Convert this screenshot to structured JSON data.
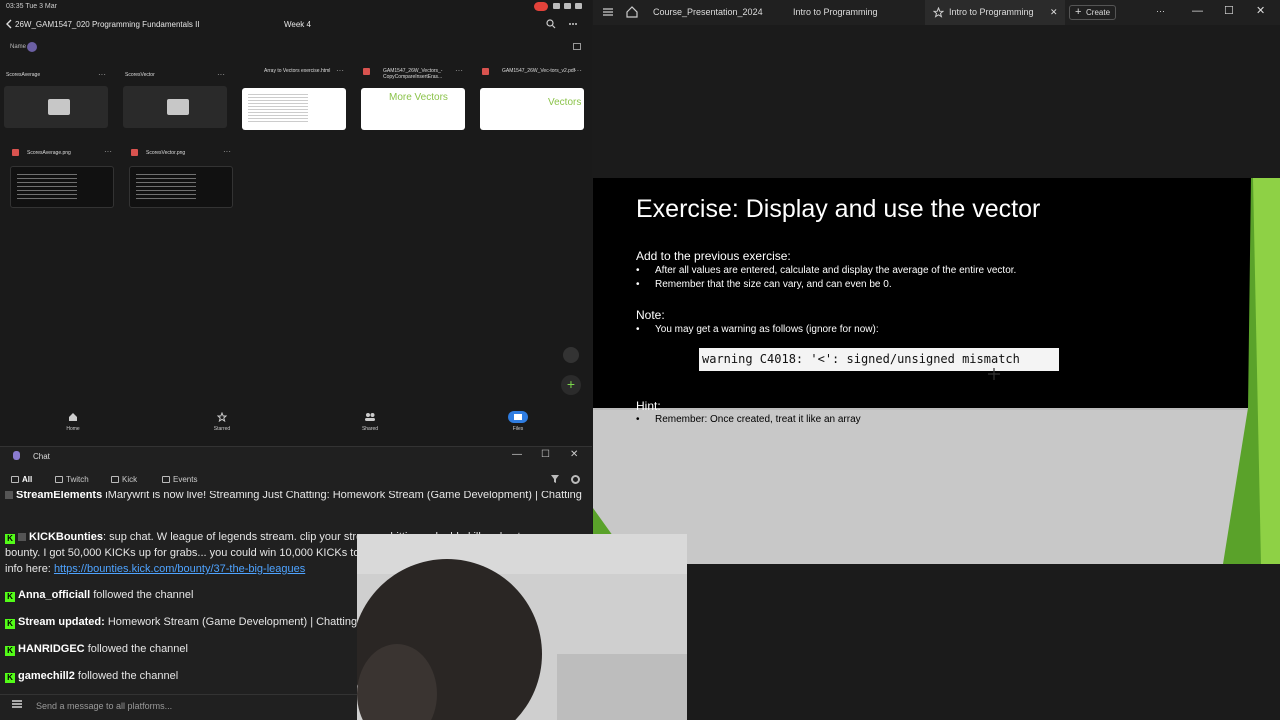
{
  "files_app": {
    "status_time": "03:35  Tue 3 Mar",
    "breadcrumb": "26W_GAM1547_020 Programming Fundamentals II",
    "folder_title": "Week 4",
    "sort_label": "Name",
    "items": [
      {
        "name": "ScoresAverage",
        "kind": "folder"
      },
      {
        "name": "ScoresVector",
        "kind": "folder"
      },
      {
        "name": "Array to Vectors exercise.html",
        "kind": "html"
      },
      {
        "name": "GAM1547_26W_Vectors_-CopyCompareInsertEras...",
        "kind": "pdf",
        "thumb_text": "More Vectors"
      },
      {
        "name": "GAM1547_26W_Vec-tors_v2.pdf",
        "kind": "pdf",
        "thumb_text": "Vectors"
      },
      {
        "name": "ScoresAverage.png",
        "kind": "image"
      },
      {
        "name": "ScoresVector.png",
        "kind": "image"
      }
    ],
    "nav": {
      "home": "Home",
      "starred": "Starred",
      "shared": "Shared",
      "files": "Files"
    }
  },
  "chat": {
    "title": "Chat",
    "tabs": {
      "all": "All",
      "twitch": "Twitch",
      "kick": "Kick",
      "events": "Events"
    },
    "messages": [
      {
        "user": "StreamElements",
        "text": "iMarywrit is now live! Streaming Just Chatting: Homework Stream (Game Development) | Chatting"
      },
      {
        "user": "KICKBounties",
        "text": "sup chat. W league of legends stream. clip your streamer hitting a double kill and enter my bounty. I got 50,000 KICKs up for grabs... you could win 10,000 KICKs to send gifts to ya fav streamer check out the info here:",
        "link": "https://bounties.kick.com/bounty/37-the-big-leagues"
      },
      {
        "user": "Anna_officiall",
        "text": "followed the channel"
      },
      {
        "user": "Stream updated:",
        "text": "Homework Stream (Game Development) | Chatting (Just Chatting)"
      },
      {
        "user": "HANRIDGEC",
        "text": "followed the channel"
      },
      {
        "user": "gamechill2",
        "text": "followed the channel"
      }
    ],
    "input_placeholder": "Send a message to all platforms..."
  },
  "presentation": {
    "tabs": [
      "Course_Presentation_2024",
      "Intro to Programming",
      "Intro to Programming"
    ],
    "create_label": "Create",
    "slide": {
      "title": "Exercise: Display and use the vector",
      "intro": "Add to the previous exercise:",
      "bullets": [
        "After all values are entered, calculate and display the average of the entire vector.",
        "Remember that the size can vary, and can even be 0."
      ],
      "note_heading": "Note:",
      "note_bullet": "You may get a warning as follows (ignore for now):",
      "code": "warning C4018: '<': signed/unsigned mismatch",
      "hint_heading": "Hint:",
      "hint_bullet": "Remember: Once created, treat it like an array"
    }
  },
  "colors": {
    "kick_green": "#53fc18",
    "accent_blue": "#2f7de1",
    "link_blue": "#4ea3ff",
    "slide_green": "#6fbf2a"
  }
}
